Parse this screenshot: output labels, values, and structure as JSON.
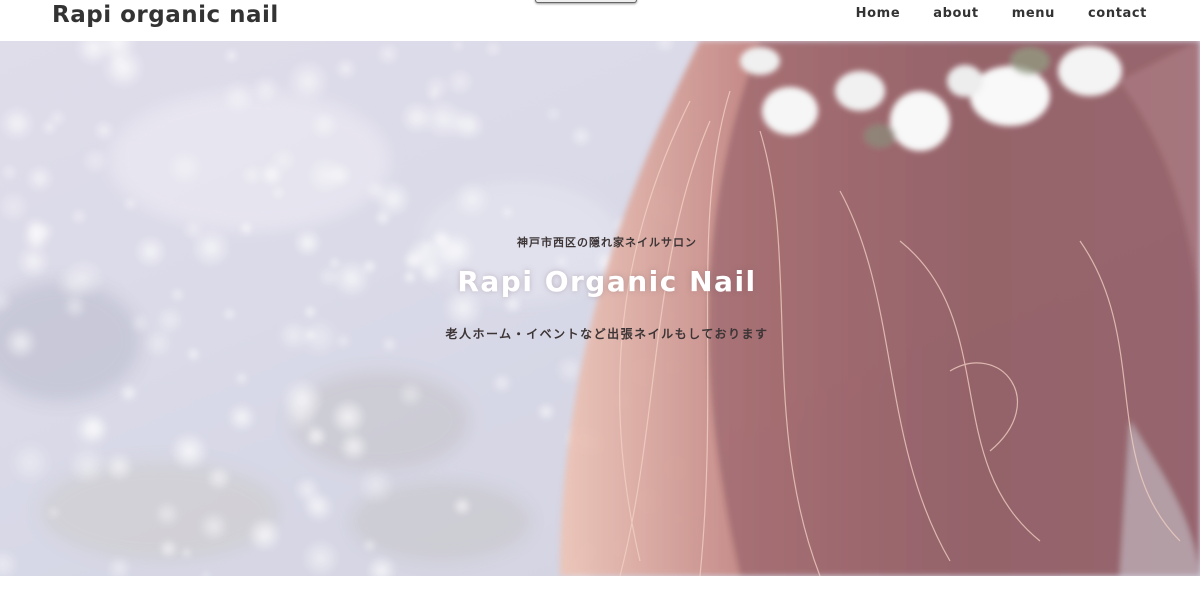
{
  "header": {
    "site_title": "Rapi organic nail",
    "nav": [
      "Home",
      "about",
      "menu",
      "contact"
    ]
  },
  "hero": {
    "kicker": "神戸市西区の隠れ家ネイルサロン",
    "title": "Rapi Organic Nail",
    "subtitle": "老人ホーム・イベントなど出張ネイルもしております"
  },
  "colors": {
    "text": "#333333",
    "hero_overlay": "#c9c0d6",
    "hair": "#8a4a4f",
    "flowers": "#f4f4f4"
  }
}
